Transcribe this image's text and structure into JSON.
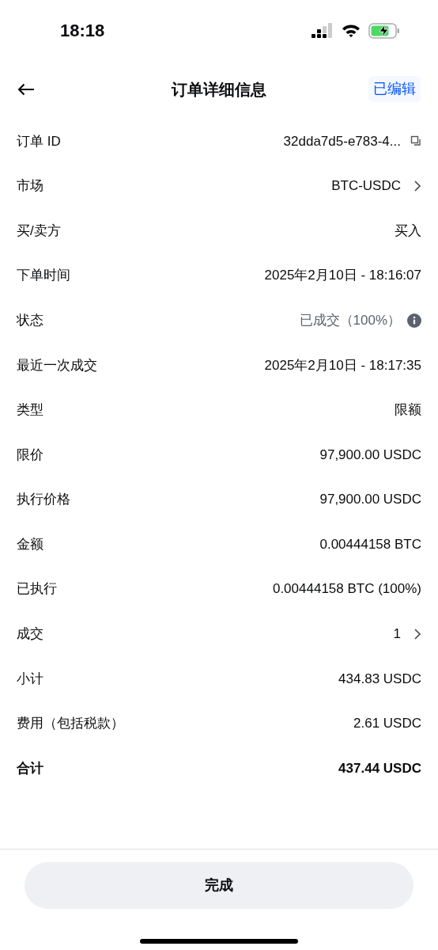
{
  "status_bar": {
    "time": "18:18"
  },
  "header": {
    "title": "订单详细信息",
    "action": "已编辑"
  },
  "rows": [
    {
      "label": "订单 ID",
      "value": "32dda7d5-e783-4...",
      "kind": "copy"
    },
    {
      "label": "市场",
      "value": "BTC-USDC",
      "kind": "link"
    },
    {
      "label": "买/卖方",
      "value": "买入",
      "kind": "plain"
    },
    {
      "label": "下单时间",
      "value": "2025年2月10日 - 18:16:07",
      "kind": "plain"
    },
    {
      "label": "状态",
      "value": "已成交（100%）",
      "kind": "status"
    },
    {
      "label": "最近一次成交",
      "value": "2025年2月10日 - 18:17:35",
      "kind": "plain"
    },
    {
      "label": "类型",
      "value": "限额",
      "kind": "plain"
    },
    {
      "label": "限价",
      "value": "97,900.00 USDC",
      "kind": "plain"
    },
    {
      "label": "执行价格",
      "value": "97,900.00 USDC",
      "kind": "plain"
    },
    {
      "label": "金额",
      "value": "0.00444158 BTC",
      "kind": "plain"
    },
    {
      "label": "已执行",
      "value": "0.00444158 BTC (100%)",
      "kind": "plain"
    },
    {
      "label": "成交",
      "value": "1",
      "kind": "link"
    },
    {
      "label": "小计",
      "value": "434.83 USDC",
      "kind": "plain"
    },
    {
      "label": "费用（包括税款）",
      "value": "2.61 USDC",
      "kind": "plain"
    },
    {
      "label": "合计",
      "value": "437.44 USDC",
      "kind": "total"
    }
  ],
  "footer": {
    "button": "完成"
  }
}
